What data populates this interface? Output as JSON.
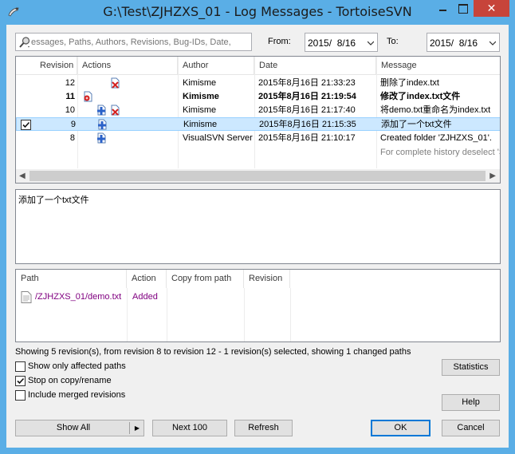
{
  "window": {
    "title": "G:\\Test\\ZJHZXS_01 - Log Messages - TortoiseSVN",
    "close_glyph": "✕"
  },
  "filter": {
    "search_placeholder": "essages, Paths, Authors, Revisions, Bug-IDs, Date,",
    "from_label": "From:",
    "from_value": "2015/  8/16",
    "to_label": "To:",
    "to_value": "2015/  8/16"
  },
  "log": {
    "columns": [
      "Revision",
      "Actions",
      "Author",
      "Date",
      "Message"
    ],
    "rows": [
      {
        "revision": "12",
        "author": "Kimisme",
        "date": "2015年8月16日 21:33:23",
        "message": "删除了index.txt"
      },
      {
        "revision": "11",
        "author": "Kimisme",
        "date": "2015年8月16日 21:19:54",
        "message": "修改了index.txt文件"
      },
      {
        "revision": "10",
        "author": "Kimisme",
        "date": "2015年8月16日 21:17:40",
        "message": "将demo.txt重命名为index.txt"
      },
      {
        "revision": "9",
        "author": "Kimisme",
        "date": "2015年8月16日 21:15:35",
        "message": "添加了一个txt文件"
      },
      {
        "revision": "8",
        "author": "VisualSVN Server",
        "date": "2015年8月16日 21:10:17",
        "message": "Created folder 'ZJHZXS_01'."
      }
    ],
    "more_hint": "For complete history deselect 'S"
  },
  "message_box": {
    "text": "添加了一个txt文件"
  },
  "paths": {
    "columns": [
      "Path",
      "Action",
      "Copy from path",
      "Revision"
    ],
    "rows": [
      {
        "path": "/ZJHZXS_01/demo.txt",
        "action": "Added",
        "copy_from": "",
        "revision": ""
      }
    ]
  },
  "status_text": "Showing 5 revision(s), from revision 8 to revision 12 - 1 revision(s) selected, showing 1 changed paths",
  "options": {
    "affected_paths": {
      "label": "Show only affected paths",
      "checked": false
    },
    "stop_on_copy": {
      "label": "Stop on copy/rename",
      "checked": true
    },
    "merged": {
      "label": "Include merged revisions",
      "checked": false
    }
  },
  "buttons": {
    "statistics": "Statistics",
    "help": "Help",
    "show_all": "Show All",
    "next_100": "Next 100",
    "refresh": "Refresh",
    "ok": "OK",
    "cancel": "Cancel"
  },
  "colors": {
    "window_frame": "#5aaee6",
    "selection": "#cce8ff",
    "path_text": "#800080",
    "close_button": "#c7443a"
  }
}
